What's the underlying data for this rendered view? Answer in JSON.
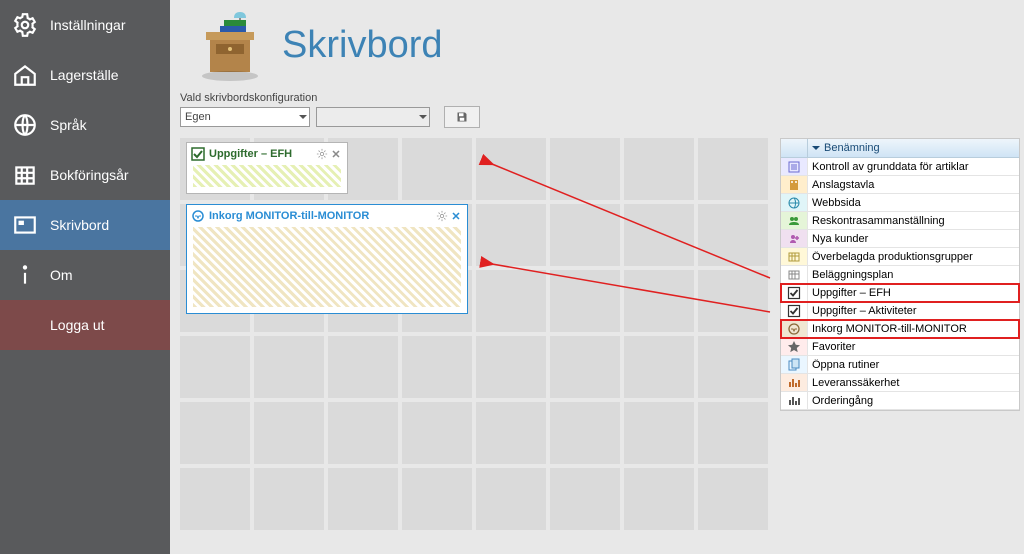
{
  "sidebar": {
    "items": [
      {
        "label": "Inställningar"
      },
      {
        "label": "Lagerställe"
      },
      {
        "label": "Språk"
      },
      {
        "label": "Bokföringsår"
      },
      {
        "label": "Skrivbord"
      },
      {
        "label": "Om"
      }
    ],
    "logout_label": "Logga ut"
  },
  "header": {
    "title": "Skrivbord",
    "config_label": "Vald skrivbordskonfiguration",
    "config_selected": "Egen"
  },
  "widgets": {
    "efh": {
      "title": "Uppgifter – EFH"
    },
    "inkorg": {
      "title": "Inkorg MONITOR-till-MONITOR"
    }
  },
  "list": {
    "header_col": "Benämning",
    "rows": [
      {
        "label": "Kontroll av grunddata för artiklar",
        "bg": "#e9e9ff",
        "hl": false
      },
      {
        "label": "Anslagstavla",
        "bg": "#ffeecc",
        "hl": false
      },
      {
        "label": "Webbsida",
        "bg": "#e0f5f8",
        "hl": false
      },
      {
        "label": "Reskontrasammanställning",
        "bg": "#e5f5d8",
        "hl": false
      },
      {
        "label": "Nya kunder",
        "bg": "#f0e0f0",
        "hl": false
      },
      {
        "label": "Överbelagda produktionsgrupper",
        "bg": "#fff8d8",
        "hl": false
      },
      {
        "label": "Beläggningsplan",
        "bg": "#ffffff",
        "hl": false
      },
      {
        "label": "Uppgifter – EFH",
        "bg": "#ffffff",
        "hl": true
      },
      {
        "label": "Uppgifter – Aktiviteter",
        "bg": "#ffffff",
        "hl": false
      },
      {
        "label": "Inkorg MONITOR-till-MONITOR",
        "bg": "#f0e7d2",
        "hl": true
      },
      {
        "label": "Favoriter",
        "bg": "#ffecec",
        "hl": false
      },
      {
        "label": "Öppna rutiner",
        "bg": "#eaf6ff",
        "hl": false
      },
      {
        "label": "Leveranssäkerhet",
        "bg": "#fdece0",
        "hl": false
      },
      {
        "label": "Orderingång",
        "bg": "#ffffff",
        "hl": false
      }
    ]
  }
}
